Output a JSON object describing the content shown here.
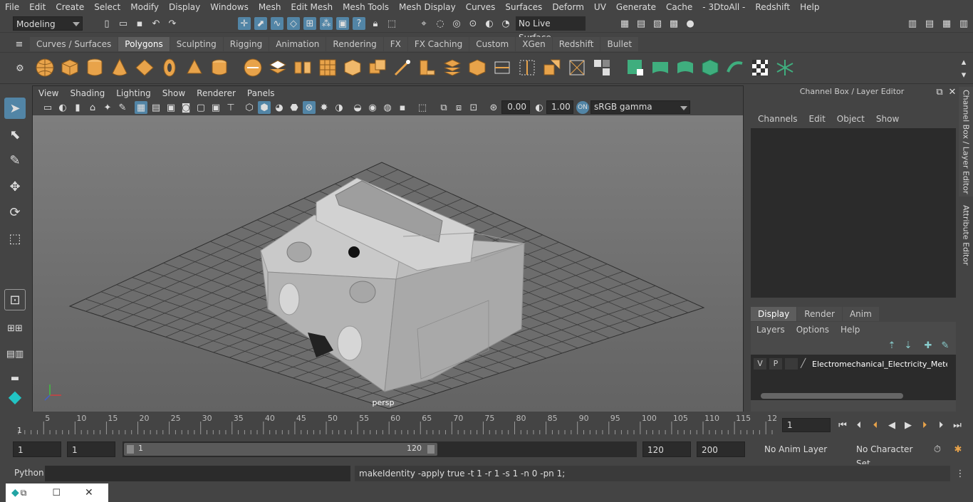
{
  "menu": [
    "File",
    "Edit",
    "Create",
    "Select",
    "Modify",
    "Display",
    "Windows",
    "Mesh",
    "Edit Mesh",
    "Mesh Tools",
    "Mesh Display",
    "Curves",
    "Surfaces",
    "Deform",
    "UV",
    "Generate",
    "Cache",
    "- 3DtoAll -",
    "Redshift",
    "Help"
  ],
  "status": {
    "mode": "Modeling",
    "live_surface": "No Live Surface"
  },
  "shelf_tabs": [
    "Curves / Surfaces",
    "Polygons",
    "Sculpting",
    "Rigging",
    "Animation",
    "Rendering",
    "FX",
    "FX Caching",
    "Custom",
    "XGen",
    "Redshift",
    "Bullet"
  ],
  "active_shelf_tab": "Polygons",
  "panel_menu": [
    "View",
    "Shading",
    "Lighting",
    "Show",
    "Renderer",
    "Panels"
  ],
  "panel_bar": {
    "exposure": "0.00",
    "gamma": "1.00",
    "colorspace": "sRGB gamma"
  },
  "viewport": {
    "camera_label": "persp"
  },
  "channel_box": {
    "title": "Channel Box / Layer Editor",
    "menu": [
      "Channels",
      "Edit",
      "Object",
      "Show"
    ],
    "tabs": [
      "Display",
      "Render",
      "Anim"
    ],
    "active_tab": "Display",
    "layer_menu": [
      "Layers",
      "Options",
      "Help"
    ],
    "layer": {
      "v": "V",
      "p": "P",
      "name": "Electromechanical_Electricity_Meter_C"
    }
  },
  "side_tabs": [
    "Channel Box / Layer Editor",
    "Attribute Editor"
  ],
  "timeline": {
    "ticks": [
      "5",
      "10",
      "15",
      "20",
      "25",
      "30",
      "35",
      "40",
      "45",
      "50",
      "55",
      "60",
      "65",
      "70",
      "75",
      "80",
      "85",
      "90",
      "95",
      "100",
      "105",
      "110",
      "115",
      "12"
    ],
    "start_marker": "1",
    "current_frame": "1"
  },
  "range": {
    "start": "1",
    "current": "1",
    "slider_start": "1",
    "slider_end": "120",
    "end": "120",
    "max": "200",
    "anim_layer": "No Anim Layer",
    "char_set": "No Character Set"
  },
  "cmd": {
    "lang": "Python",
    "output": "makeIdentity -apply true -t 1 -r 1 -s 1 -n 0 -pn 1;"
  },
  "colors": {
    "accent": "#5285a6",
    "mesh": "#c8c8c8",
    "icon_orange": "#e8a34a",
    "icon_green": "#3fae7e"
  }
}
